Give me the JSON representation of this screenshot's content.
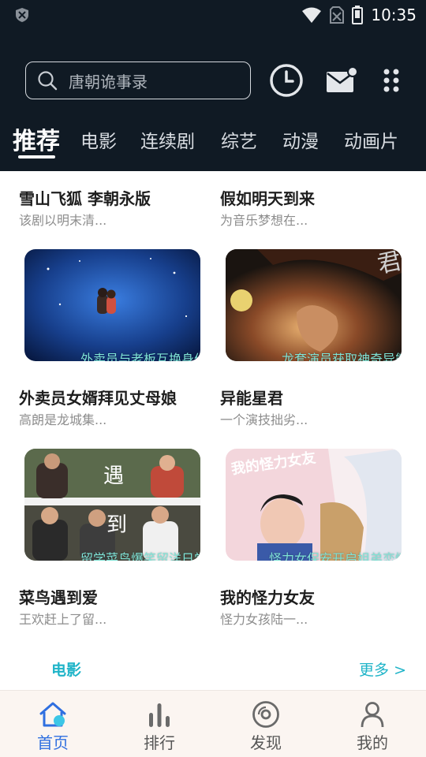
{
  "status_bar": {
    "time": "10:35"
  },
  "search": {
    "placeholder": "唐朝诡事录"
  },
  "tabs": [
    {
      "label": "推荐",
      "active": true
    },
    {
      "label": "电影"
    },
    {
      "label": "连续剧"
    },
    {
      "label": "综艺"
    },
    {
      "label": "动漫"
    },
    {
      "label": "动画片"
    }
  ],
  "top_items": [
    {
      "title": "雪山飞狐 李朝永版",
      "desc": "该剧以明末清..."
    },
    {
      "title": "假如明天到来",
      "desc": "为音乐梦想在..."
    }
  ],
  "cards": [
    {
      "title": "外卖员女婿拜见丈母娘",
      "desc": "高朗是龙城集...",
      "caption": "外卖员与老板互换身份"
    },
    {
      "title": "异能星君",
      "desc": "一个演技拙劣...",
      "caption": "龙套演员获取神奇异能"
    },
    {
      "title": "菜鸟遇到爱",
      "desc": "王欢赶上了留...",
      "caption": "留学菜鸟爆笑留洋日常",
      "poster_text": [
        "遇",
        "到"
      ]
    },
    {
      "title": "我的怪力女友",
      "desc": "怪力女孩陆一...",
      "caption": "怪力女保安开启姐弟恋情",
      "poster_text": "我的怪力女友"
    }
  ],
  "section": {
    "name": "电影",
    "more": "更多 >"
  },
  "bottom_nav": [
    {
      "label": "首页",
      "active": true
    },
    {
      "label": "排行"
    },
    {
      "label": "发现"
    },
    {
      "label": "我的"
    }
  ],
  "colors": {
    "header_bg": "#101a24",
    "accent": "#1fb4c8",
    "nav_active": "#2f6fe0",
    "caption": "#7fe3d6"
  }
}
